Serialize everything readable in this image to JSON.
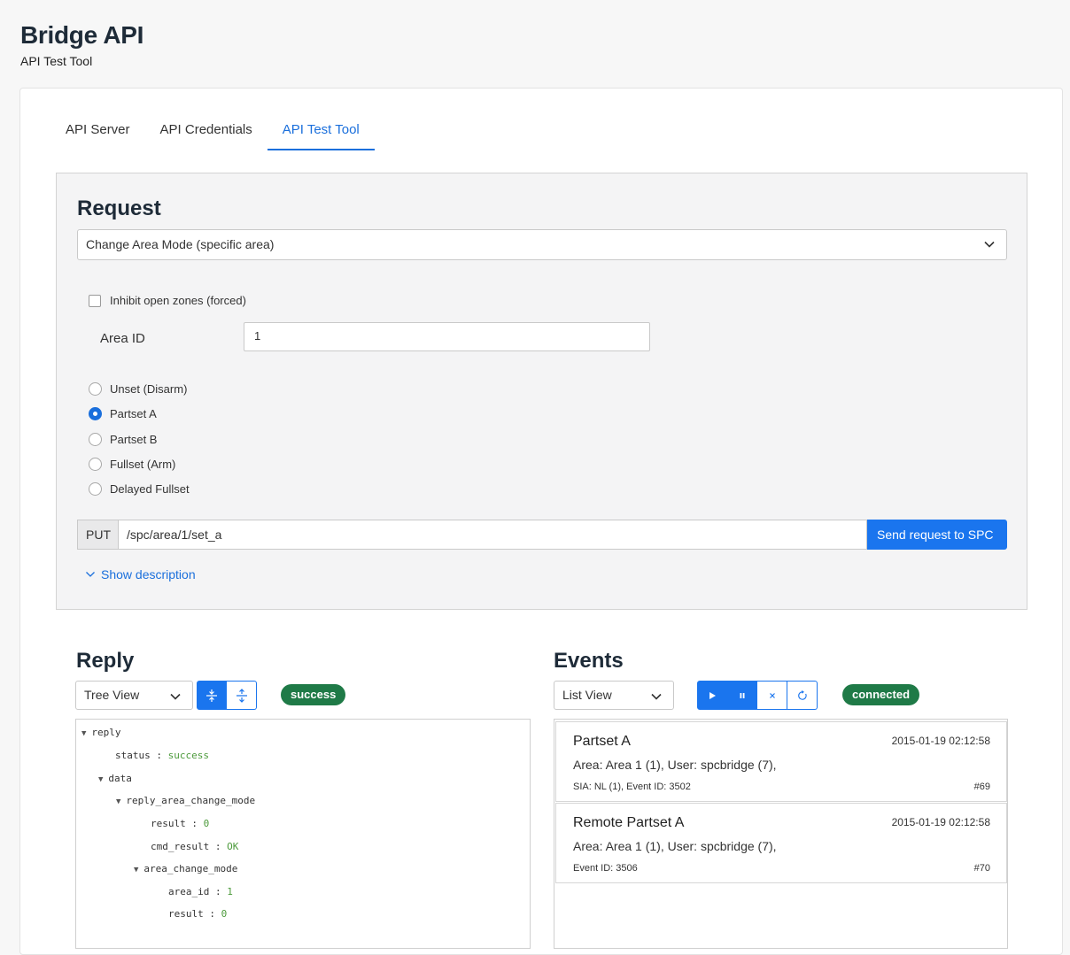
{
  "header": {
    "title": "Bridge API",
    "subtitle": "API Test Tool"
  },
  "tabs": [
    {
      "label": "API Server",
      "active": false
    },
    {
      "label": "API Credentials",
      "active": false
    },
    {
      "label": "API Test Tool",
      "active": true
    }
  ],
  "request": {
    "heading": "Request",
    "selected_request": "Change Area Mode (specific area)",
    "inhibit_checkbox": {
      "label": "Inhibit open zones (forced)",
      "checked": false
    },
    "area_id": {
      "label": "Area ID",
      "value": "1"
    },
    "modes": [
      {
        "label": "Unset (Disarm)",
        "checked": false
      },
      {
        "label": "Partset A",
        "checked": true
      },
      {
        "label": "Partset B",
        "checked": false
      },
      {
        "label": "Fullset (Arm)",
        "checked": false
      },
      {
        "label": "Delayed Fullset",
        "checked": false
      }
    ],
    "method": "PUT",
    "url": "/spc/area/1/set_a",
    "send_label": "Send request to SPC",
    "show_description_label": "Show description"
  },
  "reply": {
    "heading": "Reply",
    "view": "Tree View",
    "status_badge": "success",
    "tree": [
      {
        "key": "reply",
        "expandable": true
      },
      {
        "key": "status",
        "value": "success"
      },
      {
        "key": "data",
        "expandable": true
      },
      {
        "key": "reply_area_change_mode",
        "expandable": true
      },
      {
        "key": "result",
        "value": "0"
      },
      {
        "key": "cmd_result",
        "value": "OK"
      },
      {
        "key": "area_change_mode",
        "expandable": true
      },
      {
        "key": "area_id",
        "value": "1"
      },
      {
        "key": "result",
        "value": "0"
      }
    ]
  },
  "events": {
    "heading": "Events",
    "view": "List View",
    "status_badge": "connected",
    "list": [
      {
        "title": "Partset A",
        "time": "2015-01-19 02:12:58",
        "detail": "Area: Area 1 (1), User: spcbridge (7),",
        "meta": "SIA: NL (1), Event ID: 3502",
        "number": "#69"
      },
      {
        "title": "Remote Partset A",
        "time": "2015-01-19 02:12:58",
        "detail": "Area: Area 1 (1), User: spcbridge (7),",
        "meta": "Event ID: 3506",
        "number": "#70"
      }
    ]
  },
  "colors": {
    "accent": "#1a75ee",
    "badge_green": "#1f7a47",
    "tree_value": "#4c9a3b"
  },
  "icons": [
    "chevron-down-icon",
    "expand-all-icon",
    "collapse-all-icon",
    "play-icon",
    "pause-icon",
    "clear-icon",
    "refresh-icon",
    "caret-down-icon"
  ]
}
